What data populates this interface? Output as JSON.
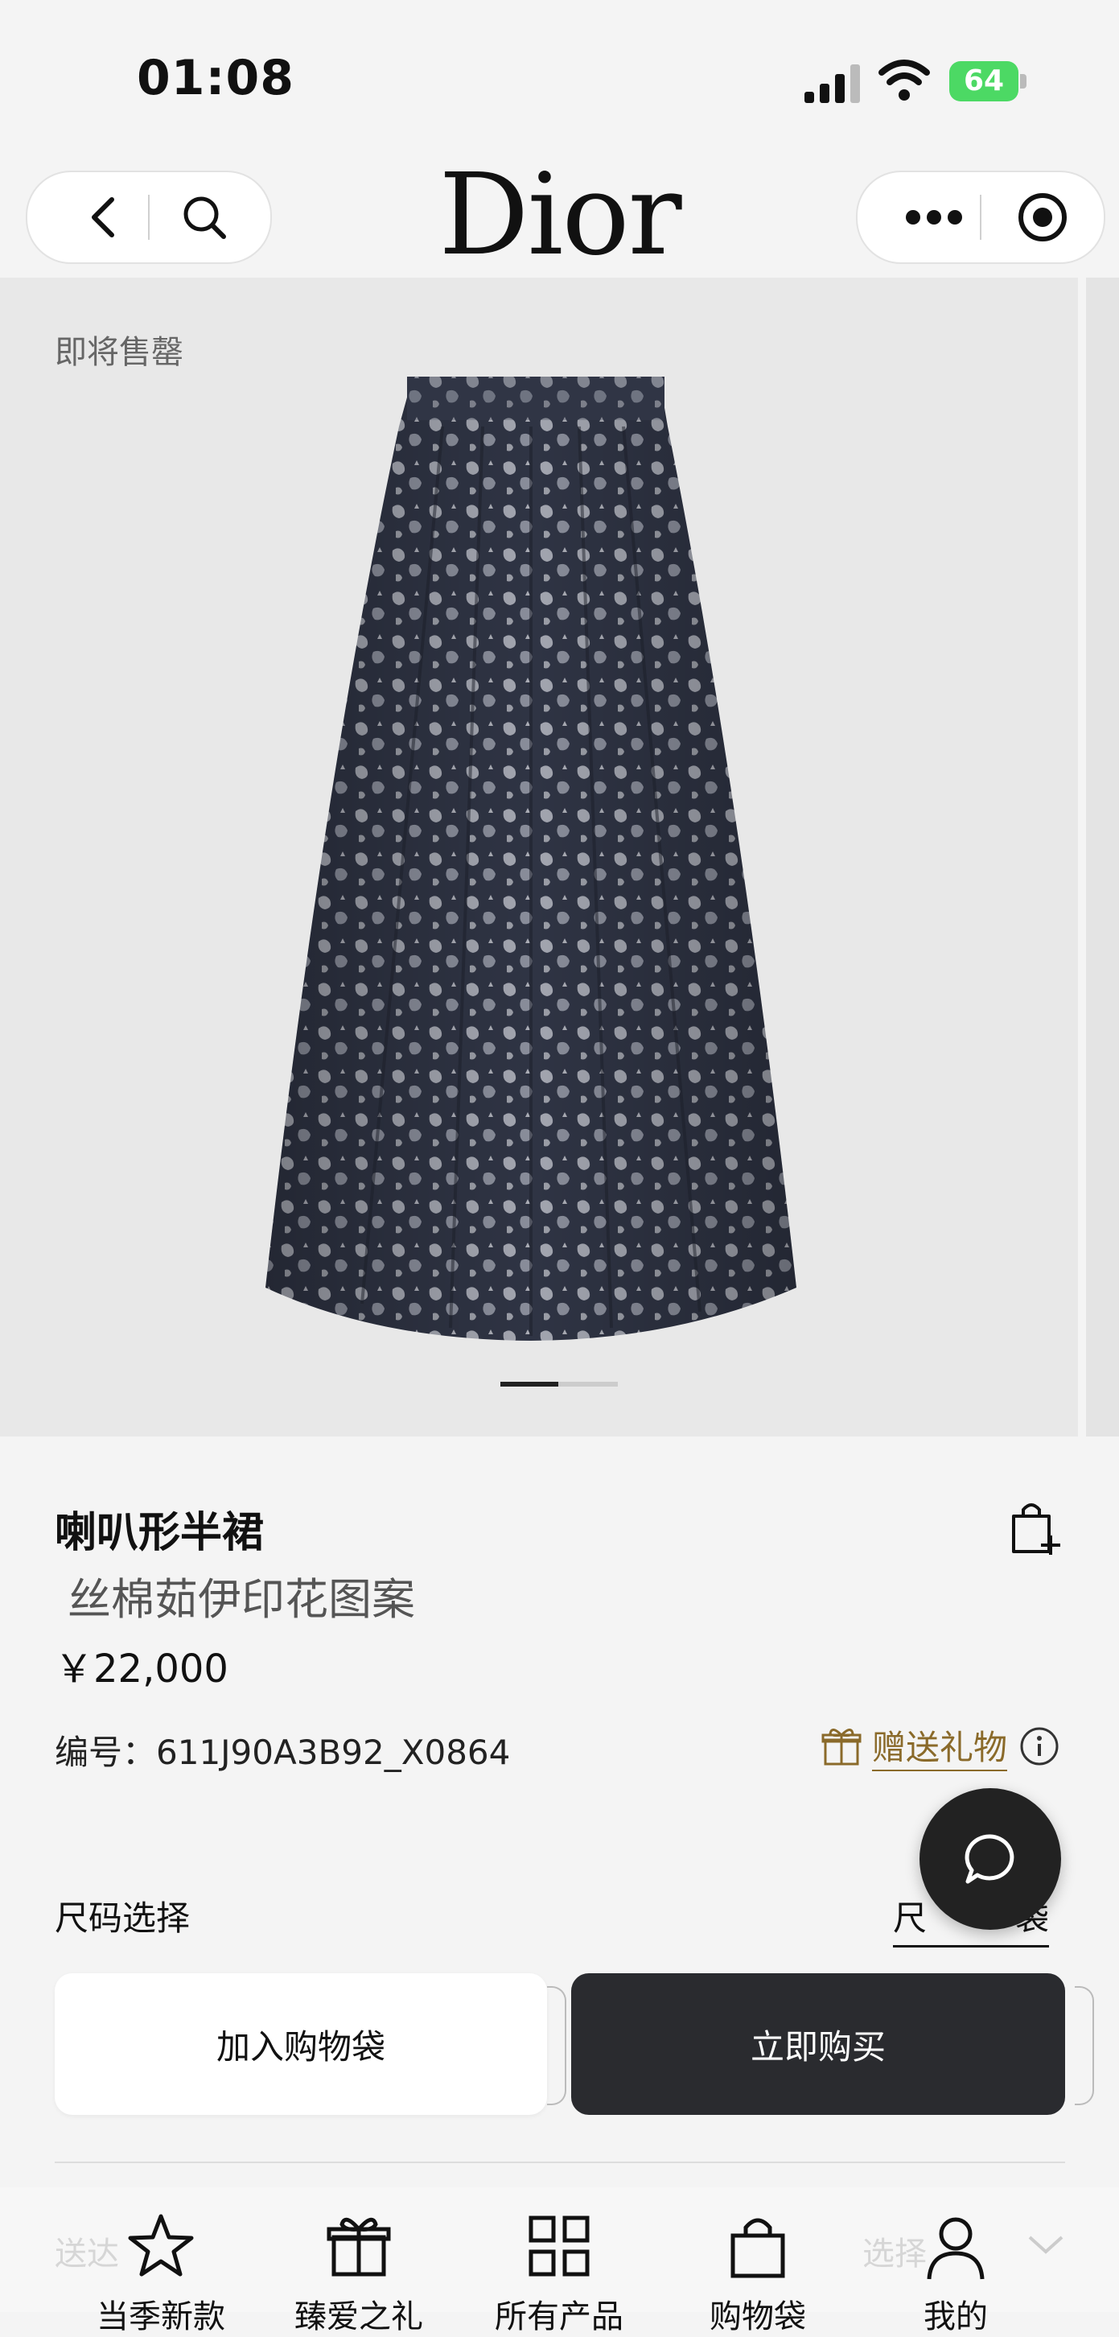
{
  "status_bar": {
    "time": "01:08",
    "battery": "64"
  },
  "nav": {
    "brand": "Dior"
  },
  "gallery": {
    "badge": "即将售罄",
    "page_count": 2,
    "current_page": 1
  },
  "product": {
    "title": "喇叭形半裙",
    "subtitle": "丝棉茹伊印花图案",
    "price": "￥22,000",
    "sku": "编号：611J90A3B92_X0864",
    "gift_label": "赠送礼物"
  },
  "size": {
    "label": "尺码选择",
    "guide_partial": "尺",
    "guide_tail": "袋"
  },
  "buttons": {
    "add_to_bag": "加入购物袋",
    "buy_now": "立即购买"
  },
  "obscured": {
    "left": "送达",
    "right": "选择"
  },
  "tabs": [
    {
      "label": "当季新款",
      "icon": "star-icon"
    },
    {
      "label": "臻爱之礼",
      "icon": "gift-icon"
    },
    {
      "label": "所有产品",
      "icon": "grid-icon"
    },
    {
      "label": "购物袋",
      "icon": "bag-icon"
    },
    {
      "label": "我的",
      "icon": "person-icon"
    }
  ]
}
